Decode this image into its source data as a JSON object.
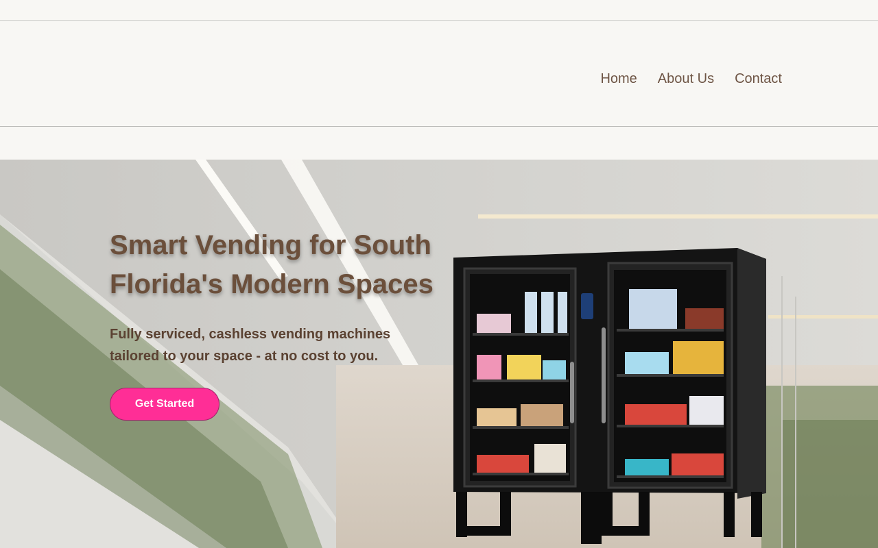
{
  "nav": {
    "home": "Home",
    "about": "About Us",
    "contact": "Contact"
  },
  "hero": {
    "headline": "Smart Vending for South Florida's Modern Spaces",
    "subtext": "Fully serviced, cashless vending machines tailored to your space - at no cost to you.",
    "cta_label": "Get Started"
  },
  "colors": {
    "nav_text": "#6e5545",
    "headline": "#6b4f3b",
    "cta_background": "#ff2e96",
    "page_background": "#f8f7f4"
  },
  "icons": [
    "vending-machine-image",
    "card-reader-icon"
  ]
}
